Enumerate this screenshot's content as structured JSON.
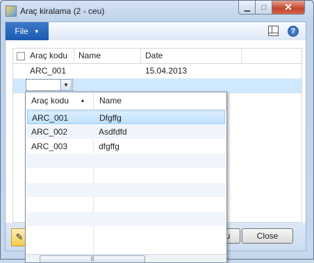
{
  "window": {
    "title": "Araç kiralama (2 - ceu)"
  },
  "ribbon": {
    "file_label": "File",
    "help_glyph": "?"
  },
  "grid": {
    "headers": [
      "Araç kodu",
      "Name",
      "Date"
    ],
    "rows": [
      {
        "code": "ARC_001",
        "name": "",
        "date": "15.04.2013"
      }
    ]
  },
  "lookup": {
    "headers": [
      "Araç kodu",
      "Name"
    ],
    "rows": [
      {
        "code": "ARC_001",
        "name": "Dfgffg"
      },
      {
        "code": "ARC_002",
        "name": "Asdfdfd"
      },
      {
        "code": "ARC_003",
        "name": "dfgffg"
      }
    ]
  },
  "footer": {
    "partial_label": "u",
    "close_label": "Close"
  },
  "colors": {
    "selection": "#cfe8fb",
    "file_button": "#1b5bb0",
    "close_caption": "#c2452e"
  }
}
